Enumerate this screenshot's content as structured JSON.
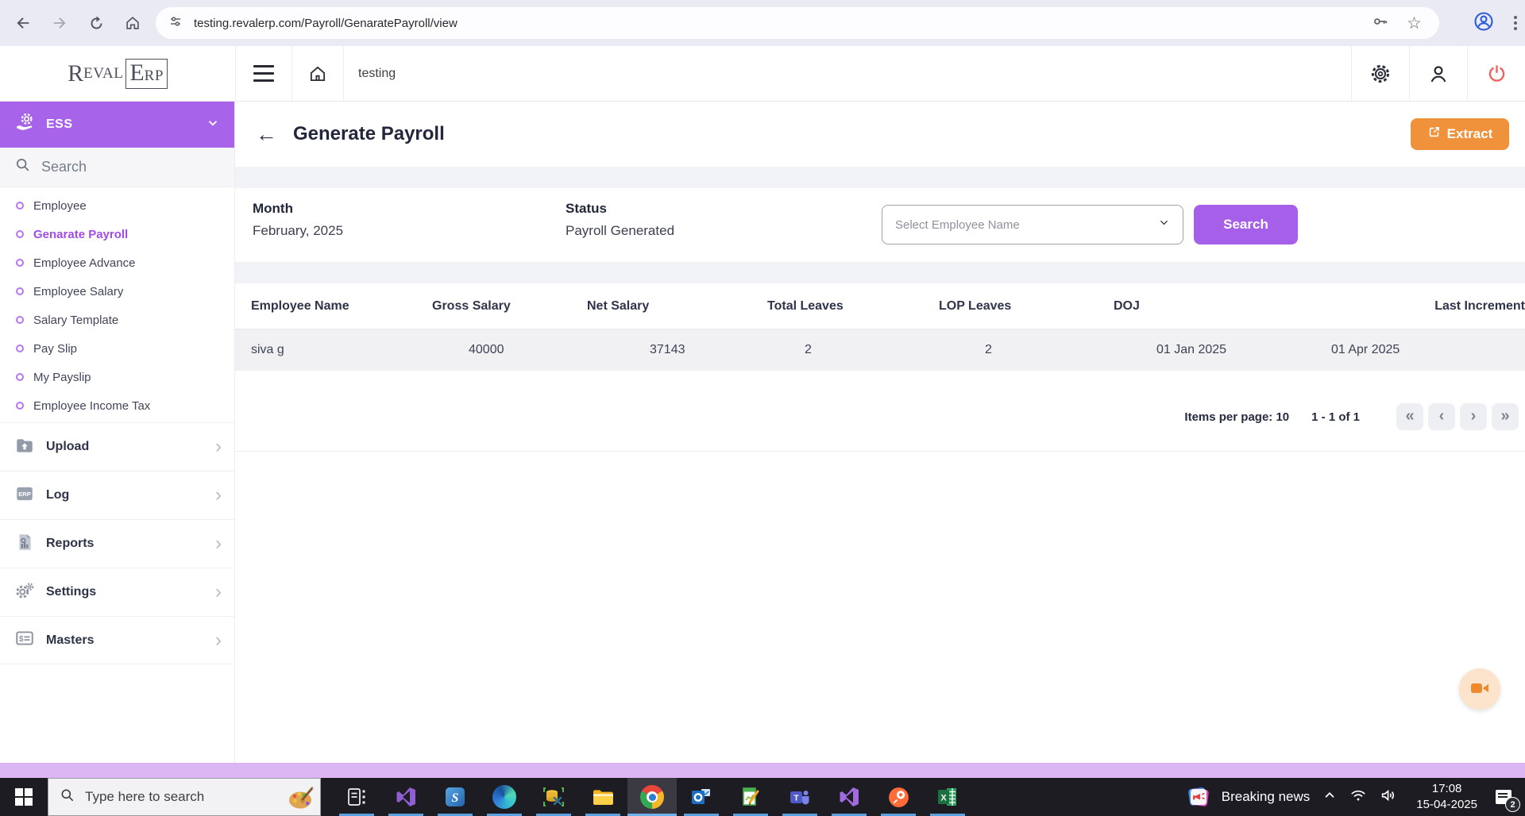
{
  "browser": {
    "url": "testing.revalerp.com/Payroll/GenaratePayroll/view"
  },
  "app_header": {
    "brand": {
      "prefix_cap": "R",
      "prefix_small": "EVAL",
      "box_cap": "E",
      "box_small": "RP"
    },
    "workspace": "testing"
  },
  "sidebar": {
    "module_label": "ESS",
    "search_placeholder": "Search",
    "menu": [
      {
        "label": "Employee",
        "active": false
      },
      {
        "label": "Genarate Payroll",
        "active": true
      },
      {
        "label": "Employee Advance",
        "active": false
      },
      {
        "label": "Employee Salary",
        "active": false
      },
      {
        "label": "Salary Template",
        "active": false
      },
      {
        "label": "Pay Slip",
        "active": false
      },
      {
        "label": "My Payslip",
        "active": false
      },
      {
        "label": "Employee Income Tax",
        "active": false
      }
    ],
    "groups": [
      {
        "label": "Upload",
        "icon": "upload-folder-icon"
      },
      {
        "label": "Log",
        "icon": "erp-log-icon"
      },
      {
        "label": "Reports",
        "icon": "report-document-icon"
      },
      {
        "label": "Settings",
        "icon": "gears-icon"
      },
      {
        "label": "Masters",
        "icon": "masters-card-icon"
      }
    ]
  },
  "main": {
    "title": "Generate Payroll",
    "extract_label": "Extract",
    "filters": {
      "month_label": "Month",
      "month_value": "February, 2025",
      "status_label": "Status",
      "status_value": "Payroll Generated",
      "employee_placeholder": "Select Employee Name",
      "search_label": "Search"
    },
    "table": {
      "columns": [
        "Employee Name",
        "Gross Salary",
        "Net Salary",
        "Total Leaves",
        "LOP Leaves",
        "DOJ",
        "Last Increment"
      ],
      "rows": [
        {
          "cells": [
            "siva g",
            "40000",
            "37143",
            "2",
            "2",
            "01 Jan 2025",
            "01 Apr 2025"
          ]
        }
      ]
    },
    "pagination": {
      "items_per_page_label": "Items per page: 10",
      "range_label": "1 - 1 of 1"
    }
  },
  "taskbar": {
    "search_placeholder": "Type here to search",
    "news_label": "Breaking news",
    "clock": {
      "time": "17:08",
      "date": "15-04-2025"
    },
    "notification_count": "2",
    "app_icons": [
      "task-view",
      "visual-studio",
      "ssms",
      "edge",
      "sql-config-tools",
      "file-explorer",
      "chrome",
      "outlook",
      "green-doc-tool",
      "teams",
      "visual-studio-2022",
      "postman",
      "excel"
    ]
  },
  "colors": {
    "accent_purple": "#a763ea",
    "button_purple": "#a55fe8",
    "accent_orange": "#f0923b",
    "power_red": "#f15f5f",
    "lavender_strip": "#dbb6f2"
  }
}
